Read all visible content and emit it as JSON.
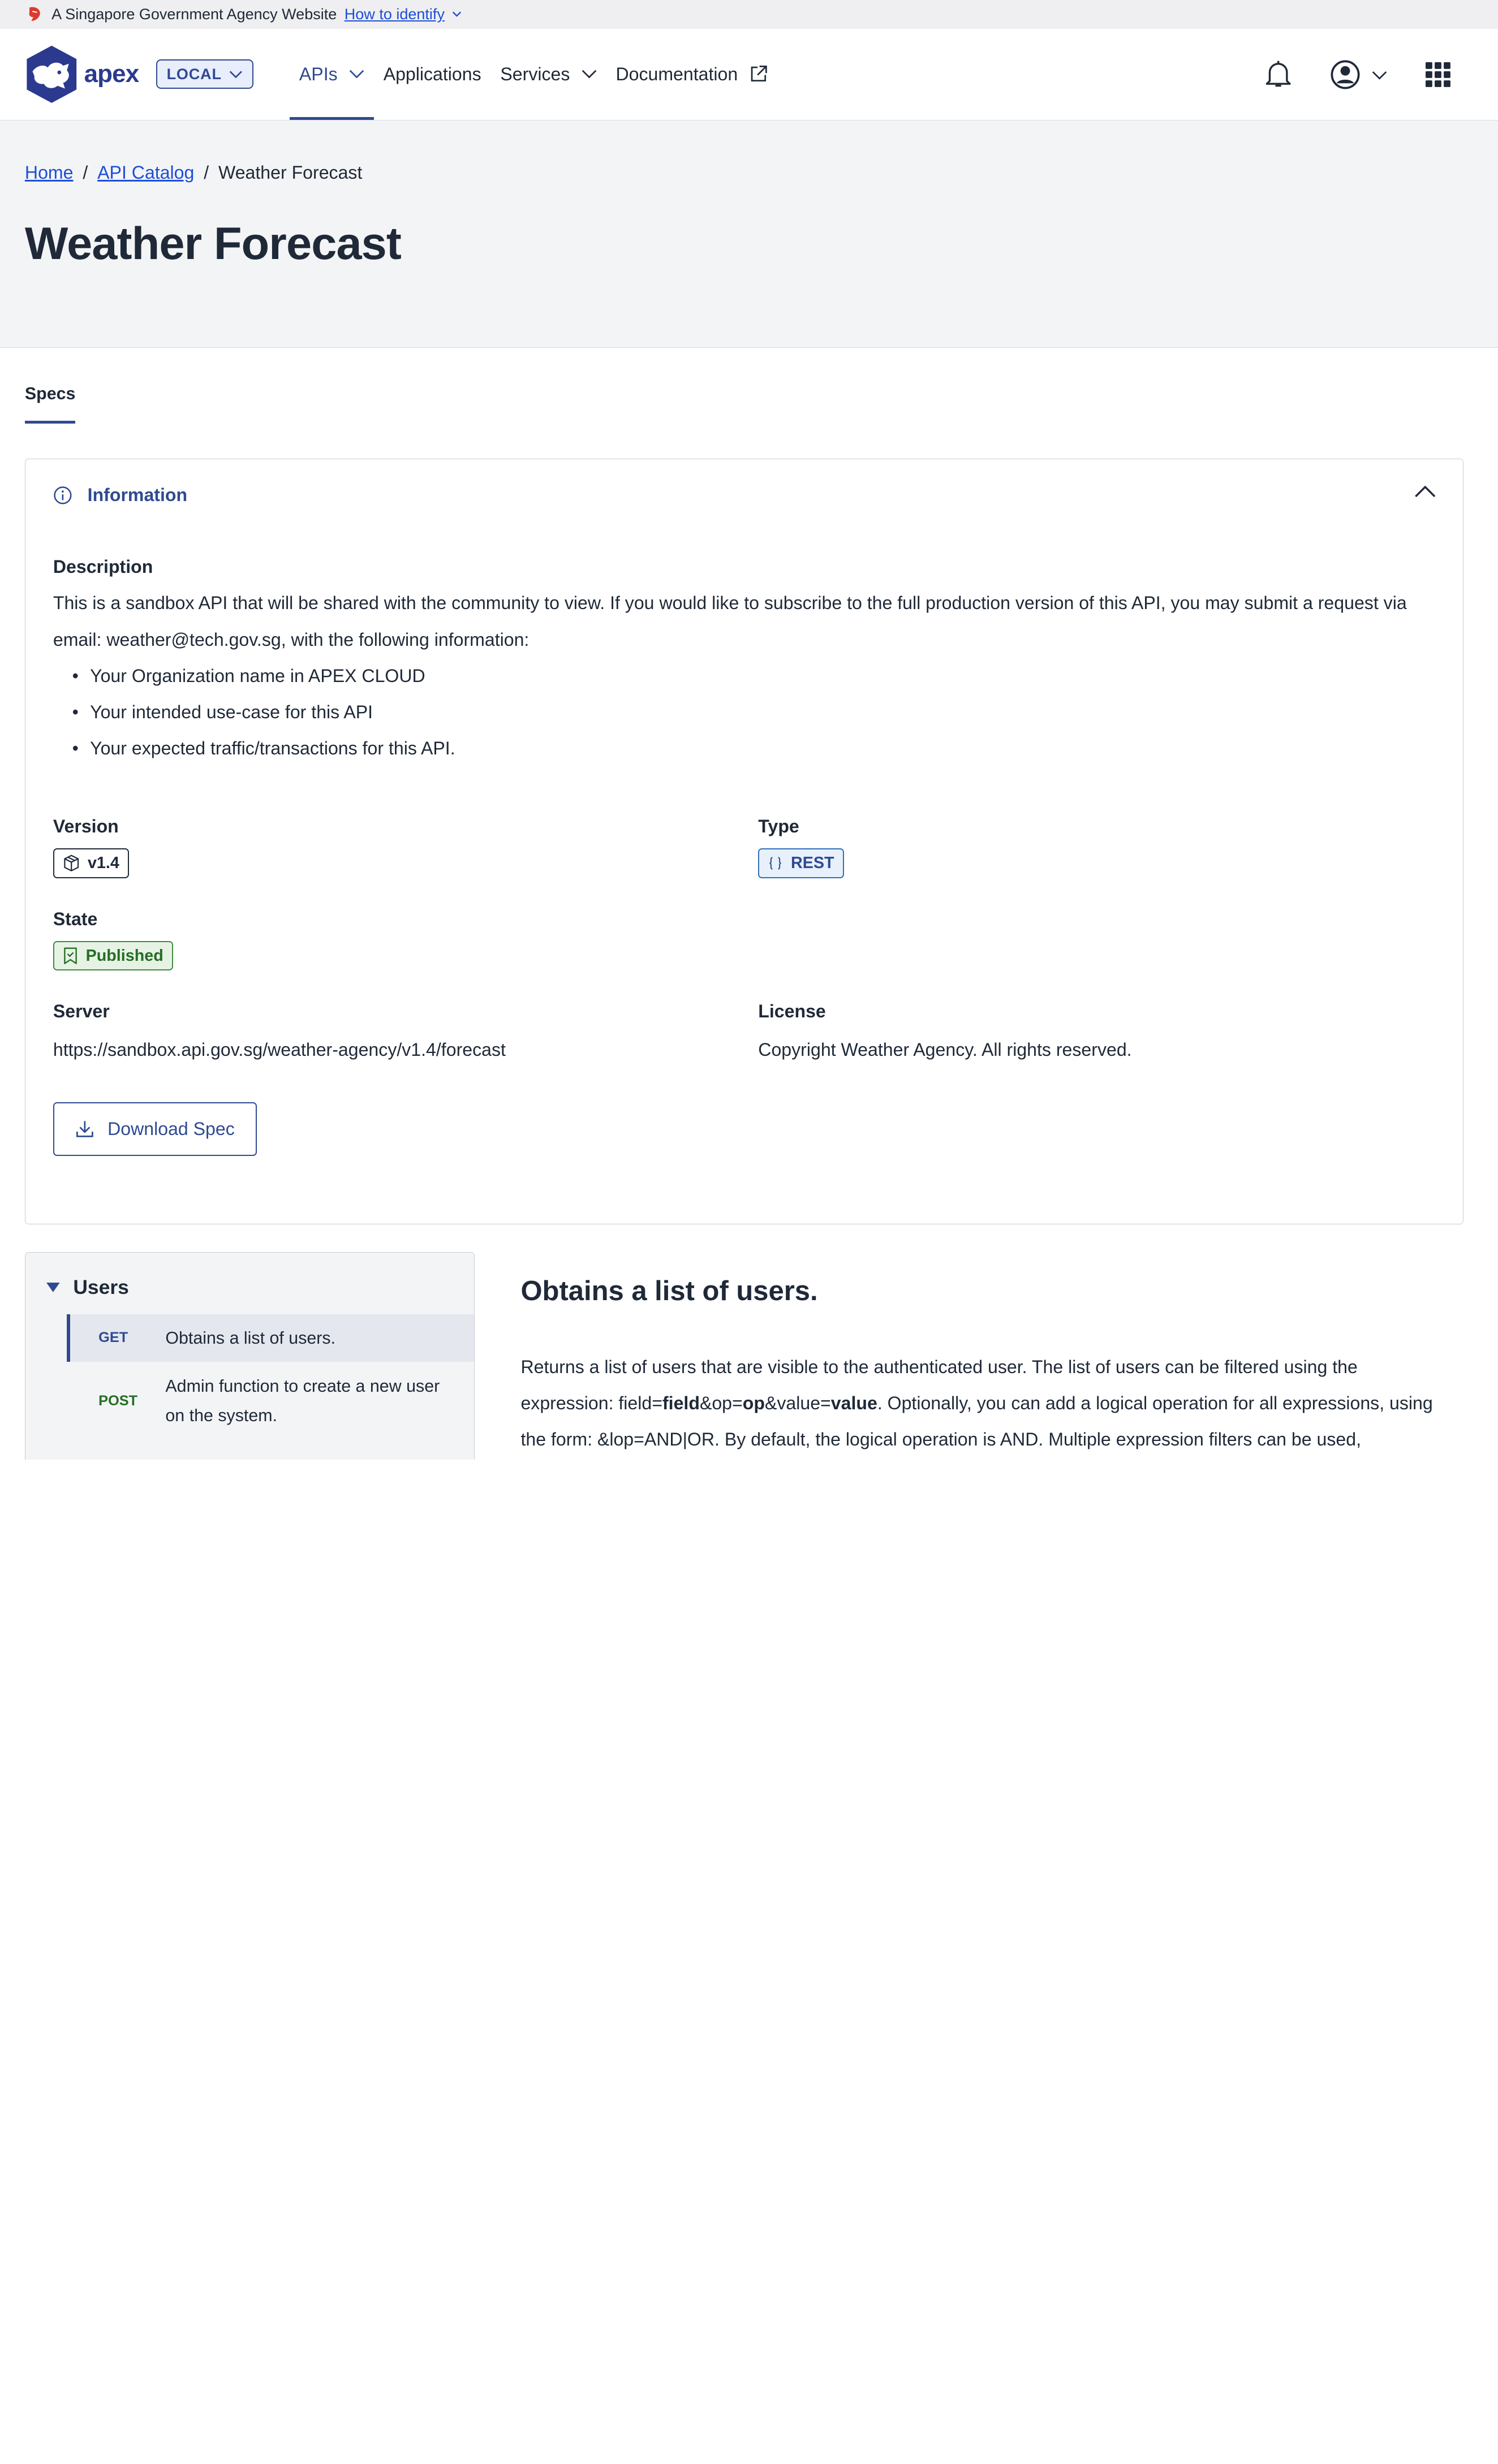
{
  "gov_banner": {
    "text": "A Singapore Government Agency Website",
    "link": "How to identify"
  },
  "header": {
    "logo_text": "apex",
    "env_badge": "LOCAL",
    "nav": [
      {
        "label": "APIs",
        "active": true,
        "has_dropdown": true
      },
      {
        "label": "Applications",
        "active": false,
        "has_dropdown": false
      },
      {
        "label": "Services",
        "active": false,
        "has_dropdown": true
      },
      {
        "label": "Documentation",
        "active": false,
        "has_dropdown": false,
        "external": true
      }
    ],
    "icons": [
      "bell-icon",
      "user-circle-icon",
      "chevron-down-icon",
      "app-grid-icon"
    ]
  },
  "breadcrumb": {
    "home": "Home",
    "catalog": "API Catalog",
    "current": "Weather Forecast",
    "separator": "/"
  },
  "page_title": "Weather Forecast",
  "tabs": [
    {
      "label": "Specs",
      "active": true
    }
  ],
  "info": {
    "title": "Information",
    "description_label": "Description",
    "description": "This is a sandbox API that will be shared with the community to view. If you would like to subscribe to the full production version of this API, you may submit a request via email: weather@tech.gov.sg, with the following information:",
    "bullets": [
      "Your Organization name in APEX CLOUD",
      "Your intended use-case for this API",
      "Your expected traffic/transactions for this API."
    ],
    "version_label": "Version",
    "version": "v1.4",
    "type_label": "Type",
    "type": "REST",
    "state_label": "State",
    "state": "Published",
    "server_label": "Server",
    "server": "https://sandbox.api.gov.sg/weather-agency/v1.4/forecast",
    "license_label": "License",
    "license": "Copyright Weather Agency. All rights reserved.",
    "download_label": "Download Spec"
  },
  "sidenav": {
    "group": "Users",
    "operations": [
      {
        "method": "GET",
        "summary": "Obtains a list of users.",
        "active": true
      },
      {
        "method": "POST",
        "summary": "Admin function to create a new user on the system.",
        "active": false
      }
    ]
  },
  "operation": {
    "title": "Obtains a list of users.",
    "desc_1": "Returns a list of users that are visible to the authenticated user. The list of users can be filtered using the expression: field=",
    "desc_b1": "field",
    "desc_2": "&op=",
    "desc_b2": "op",
    "desc_3": "&value=",
    "desc_b3": "value",
    "desc_4": ". Optionally, you can add a logical operation for all expressions, using the form: &lop=AND|OR. By default, the logical operation is AND. Multiple expression filters can be used,"
  },
  "colors": {
    "primary": "#2f4a91",
    "link": "#1d4ed8",
    "success": "#256d25",
    "hero_bg": "#f3f4f6"
  }
}
